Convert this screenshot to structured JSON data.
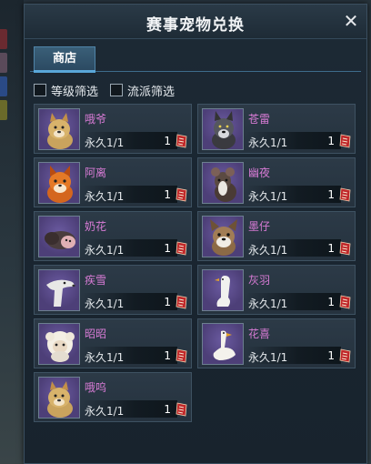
{
  "window": {
    "title": "赛事宠物兑换",
    "close_symbol": "✕"
  },
  "tabs": [
    {
      "label": "商店",
      "active": true
    }
  ],
  "filters": [
    {
      "label": "等级筛选",
      "checked": false
    },
    {
      "label": "流派筛选",
      "checked": false
    }
  ],
  "pets": [
    {
      "name": "哦爷",
      "duration": "永久1/1",
      "qty": "1",
      "icon": "shiba-dog-icon",
      "portrait_color": "#4d3f78"
    },
    {
      "name": "苍雷",
      "duration": "永久1/1",
      "qty": "1",
      "icon": "gray-wolf-icon",
      "portrait_color": "#4d3f78"
    },
    {
      "name": "阿离",
      "duration": "永久1/1",
      "qty": "1",
      "icon": "fox-icon",
      "portrait_color": "#4d3f78"
    },
    {
      "name": "幽夜",
      "duration": "永久1/1",
      "qty": "1",
      "icon": "mouse-icon",
      "portrait_color": "#4d3f78"
    },
    {
      "name": "奶花",
      "duration": "永久1/1",
      "qty": "1",
      "icon": "piglet-icon",
      "portrait_color": "#4d3f78"
    },
    {
      "name": "墨仔",
      "duration": "永久1/1",
      "qty": "1",
      "icon": "puppy-icon",
      "portrait_color": "#4d3f78"
    },
    {
      "name": "疾雪",
      "duration": "永久1/1",
      "qty": "1",
      "icon": "white-hound-icon",
      "portrait_color": "#4d3f78"
    },
    {
      "name": "灰羽",
      "duration": "永久1/1",
      "qty": "1",
      "icon": "white-goose-icon",
      "portrait_color": "#4d3f78"
    },
    {
      "name": "昭昭",
      "duration": "永久1/1",
      "qty": "1",
      "icon": "sheep-icon",
      "portrait_color": "#4d3f78"
    },
    {
      "name": "花喜",
      "duration": "永久1/1",
      "qty": "1",
      "icon": "swan-icon",
      "portrait_color": "#4d3f78"
    },
    {
      "name": "哦呜",
      "duration": "永久1/1",
      "qty": "1",
      "icon": "shiba-dog-icon",
      "portrait_color": "#4d3f78"
    }
  ],
  "colors": {
    "pet_name": "#d77bd5",
    "tab_accent": "#59a7d9",
    "cost_token": "#c0282a"
  }
}
